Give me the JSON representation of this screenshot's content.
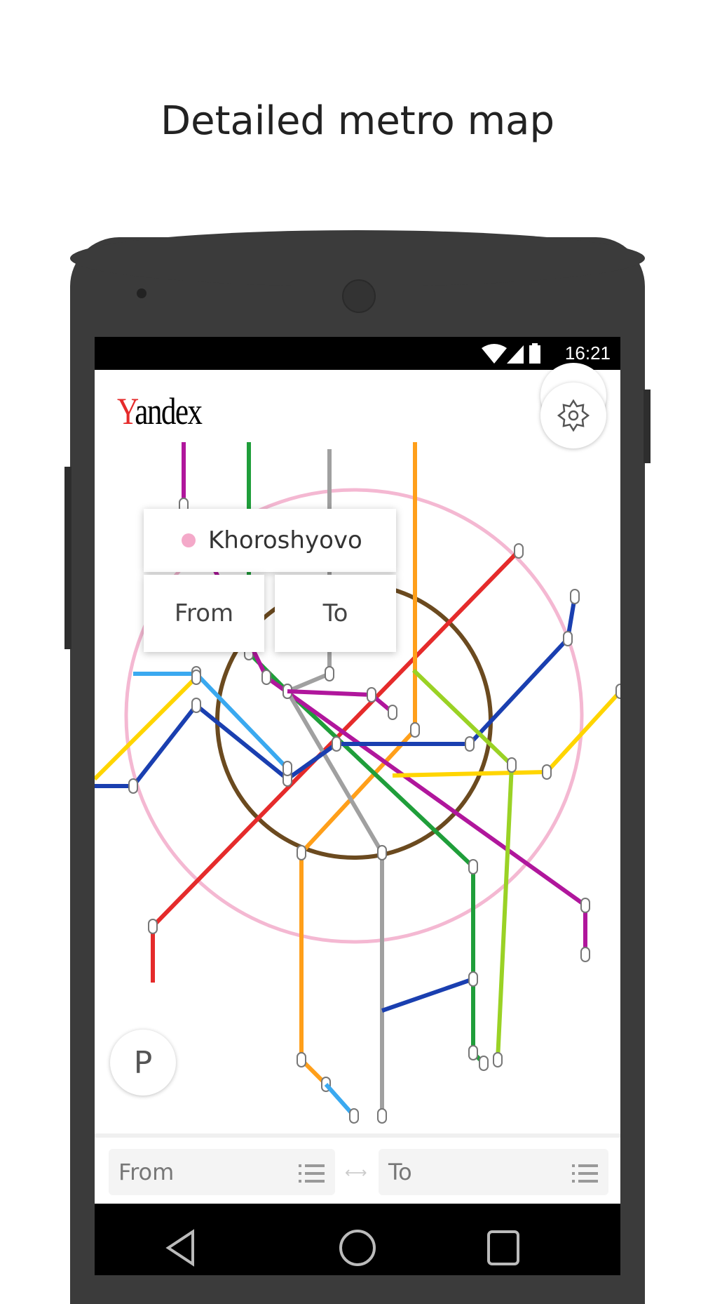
{
  "headline": "Detailed metro map",
  "status_bar": {
    "time": "16:21",
    "icons": [
      "wifi-icon",
      "signal-icon",
      "battery-icon"
    ]
  },
  "app": {
    "logo": {
      "first": "Y",
      "rest": "andex"
    },
    "settings_icon": "gear-icon",
    "parking_button": "P",
    "popup": {
      "station": "Khoroshyovo",
      "station_color": "#f4a9c9",
      "from": "From",
      "to": "To"
    },
    "route": {
      "from_placeholder": "From",
      "to_placeholder": "To",
      "swap": "⟷"
    }
  },
  "nav_bar": {
    "icons": [
      "back-icon",
      "home-icon",
      "recents-icon"
    ]
  },
  "map_lines": [
    {
      "color": "#e52b2b"
    },
    {
      "color": "#ff9f1a"
    },
    {
      "color": "#1f9e3a"
    },
    {
      "color": "#b0169c"
    },
    {
      "color": "#a0a0a0"
    },
    {
      "color": "#1a3fb0"
    },
    {
      "color": "#3aa9f0"
    },
    {
      "color": "#ffd500"
    },
    {
      "color": "#9ad225"
    },
    {
      "color": "#6b4a1f"
    },
    {
      "color": "#f4b8d2"
    }
  ]
}
